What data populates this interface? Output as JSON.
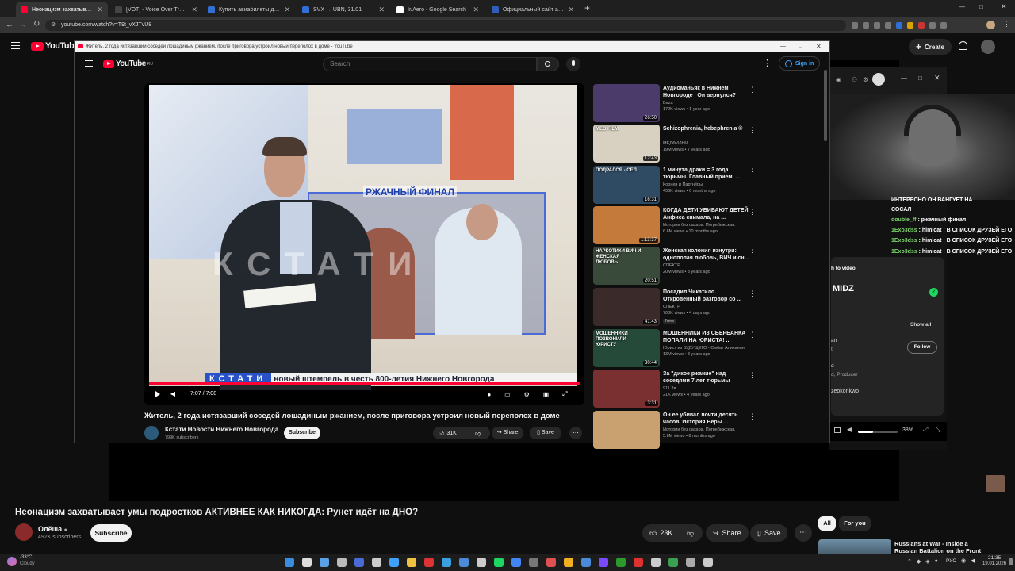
{
  "browser": {
    "tabs": [
      {
        "label": "Неонацизм захватывает умы п",
        "color": "#ff0033",
        "active": true
      },
      {
        "label": "[VOT] - Voice Over Translation",
        "color": "#444444",
        "active": false
      },
      {
        "label": "Купить авиабилеты дешево о",
        "color": "#2f6fd6",
        "active": false
      },
      {
        "label": "SVX → UBN, 31.01",
        "color": "#2f6fd6",
        "active": false
      },
      {
        "label": "Ir/Aero - Google Search",
        "color": "#ffffff",
        "active": false
      },
      {
        "label": "Официальный сайт авиакомп",
        "color": "#2d5fb8",
        "active": false
      }
    ],
    "url": "youtube.com/watch?v=T9t_vXJTvU8"
  },
  "bg_yt": {
    "logo": "YouTube",
    "create_label": "Create"
  },
  "popup": {
    "title": "Житель, 2 года истязавший соседей лошадиным ржанием, после приговора устроил новый переполох в доме - YouTube",
    "logo": "YouTube",
    "logo_sup": "RU",
    "search_placeholder": "Search",
    "sign_in": "Sign in",
    "video": {
      "caption": "РЖАЧНЫЙ ФИНАЛ",
      "watermark": "КСТАТИ",
      "ticker_brand": "КСТАТИ",
      "ticker_text": "новый штемпель в честь 800-летия Нижнего Новгорода",
      "time": "7:07 / 7:08",
      "progress": 0.998
    },
    "title_text": "Житель, 2 года истязавший соседей лошадиным ржанием, после приговора устроил новый переполох в доме",
    "channel": "Кстати Новости Нижнего Новгорода",
    "subs": "799K subscribers",
    "subscribe": "Subscribe",
    "likes": "31K",
    "share": "Share",
    "save": "Save",
    "sidebar": [
      {
        "title": "Аудиоманьяк в Нижнем Новгороде | Он вернулся?",
        "channel": "Baza",
        "meta": "172K views • 1 year ago",
        "dur": "26:50",
        "bg": "#4a3b6a",
        "thumb_text": ""
      },
      {
        "title": "Schizophrenia, hebephrenia ©",
        "channel": "МЕДФИЛЬМ",
        "meta": "19M views • 7 years ago",
        "dur": "12:43",
        "bg": "#d8d0c0",
        "thumb_text": "MED FILM"
      },
      {
        "title": "1 минута драки = 3 года тюрьмы. Главный прием, ...",
        "channel": "Корнев и Партнёры",
        "meta": "456K views • 6 months ago",
        "dur": "16:31",
        "bg": "#2f4b63",
        "thumb_text": "ПОДРАЛСЯ - СЕЛ"
      },
      {
        "title": "КОГДА ДЕТИ УБИВАЮТ ДЕТЕЙ. Анфиса снимала, на ...",
        "channel": "Истории без сахара. Погребижская.",
        "meta": "6.6M views • 10 months ago",
        "dur": "1:13:37",
        "bg": "#c47a3a",
        "thumb_text": ""
      },
      {
        "title": "Женская колония изнутри: однополая любовь, ВИЧ и сн...",
        "channel": "СПЕКТР",
        "meta": "20M views • 3 years ago",
        "dur": "20:51",
        "bg": "#3a4a3a",
        "thumb_text": "НАРКОТИКИ ВИЧ И ЖЕНСКАЯ ЛЮБОВЬ"
      },
      {
        "title": "Посадил Чикатило. Откровенный разговор со ...",
        "channel": "СПЕКТР",
        "meta": "700K views • 4 days ago",
        "dur": "41:43",
        "bg": "#3b2a2a",
        "thumb_text": "",
        "badge": "New"
      },
      {
        "title": "МОШЕННИКИ ИЗ СБЕРБАНКА ПОПАЛИ НА ЮРИСТА! ...",
        "channel": "Юрист из БУДУЩЕГО - Смбат Алиханян",
        "meta": "13M views • 3 years ago",
        "dur": "30:44",
        "bg": "#264a3a",
        "thumb_text": "МОШЕННИКИ ПОЗВОНИЛИ ЮРИСТУ"
      },
      {
        "title": "За \"дикое ржание\" над соседями 7 лет тюрьмы",
        "channel": "911 Зв",
        "meta": "21K views • 4 years ago",
        "dur": "3:31",
        "bg": "#7a3030",
        "thumb_text": ""
      },
      {
        "title": "Он ее убивал почти десять часов. История Веры ...",
        "channel": "Истории без сахара. Погребижская.",
        "meta": "5.8M views • 8 months ago",
        "dur": "",
        "bg": "#c9a070",
        "thumb_text": ""
      }
    ]
  },
  "chat": {
    "lines": [
      {
        "user": "",
        "text": "ИНТЕРЕСНО ОН ВАНГУЕТ НА",
        "color": "#ffffff"
      },
      {
        "user": "",
        "text": "СОСАЛ",
        "color": "#ffffff"
      },
      {
        "user": "double_ff",
        "text": " : ржачный финал",
        "color": "#7bd66b"
      },
      {
        "user": "1Exo3dss",
        "text": " : himicat : В СПИСОК ДРУЗЕЙ ЕГО",
        "color": "#7bd66b"
      },
      {
        "user": "1Exo3dss",
        "text": " : himicat : В СПИСОК ДРУЗЕЙ ЕГО",
        "color": "#7bd66b"
      },
      {
        "user": "1Exo3dss",
        "text": " : himicat : В СПИСОК ДРУЗЕЙ ЕГО",
        "color": "#7bd66b"
      }
    ]
  },
  "spotify": {
    "to_video": "h to video",
    "name": "MIDZ",
    "show_all": "Show all",
    "follow": "Follow",
    "role_partial": "d, Producer",
    "handle": "zeokonkwo",
    "line_an": "an",
    "line_t": "t",
    "line_d": "d",
    "volume_pct": "38%"
  },
  "main": {
    "title": "Неонацизм захватывает умы подростков АКТИВНЕЕ КАК НИКОГДА: Рунет идёт на ДНО?",
    "channel": "Олёша",
    "subs": "492K subscribers",
    "subscribe": "Subscribe",
    "likes": "23K",
    "share": "Share",
    "save": "Save",
    "chips": [
      "All",
      "For you"
    ],
    "next_title": "Russians at War - Inside a Russian Battalion on the Front"
  },
  "taskbar": {
    "weather_temp": "-33°C",
    "weather_desc": "Cloudy",
    "lang": "РУС",
    "time": "21:35",
    "date": "19.01.2026"
  },
  "colors": {
    "accent": "#ff0033",
    "chat_green": "#7bd66b",
    "spotify_green": "#1ed760"
  }
}
